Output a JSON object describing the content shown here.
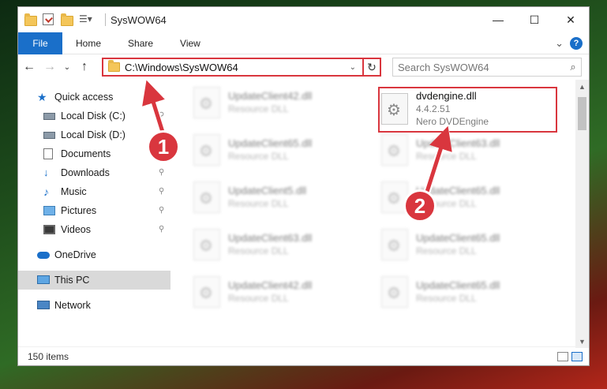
{
  "window": {
    "title": "SysWOW64",
    "minimize": "—",
    "maximize": "☐",
    "close": "✕"
  },
  "ribbon": {
    "file_tab": "File",
    "tabs": [
      "Home",
      "Share",
      "View"
    ],
    "expand": "⌄",
    "help": "?"
  },
  "nav": {
    "back": "←",
    "forward": "→",
    "recent": "⌄",
    "up": "↑",
    "address_path": "C:\\Windows\\SysWOW64",
    "address_dropdown": "⌄",
    "refresh": "↻",
    "search_placeholder": "Search SysWOW64",
    "search_icon": "⌕"
  },
  "sidebar": {
    "items": [
      {
        "label": "Quick access",
        "icon": "star-icon"
      },
      {
        "label": "Local Disk (C:)",
        "icon": "disk-icon",
        "pinned": true
      },
      {
        "label": "Local Disk (D:)",
        "icon": "disk-icon"
      },
      {
        "label": "Documents",
        "icon": "documents-icon",
        "pinned": true
      },
      {
        "label": "Downloads",
        "icon": "downloads-icon",
        "pinned": true
      },
      {
        "label": "Music",
        "icon": "music-icon",
        "pinned": true
      },
      {
        "label": "Pictures",
        "icon": "pictures-icon",
        "pinned": true
      },
      {
        "label": "Videos",
        "icon": "videos-icon",
        "pinned": true
      },
      {
        "label": "OneDrive",
        "icon": "onedrive-icon"
      },
      {
        "label": "This PC",
        "icon": "this-pc-icon",
        "selected": true
      },
      {
        "label": "Network",
        "icon": "network-icon"
      }
    ],
    "pin_glyph": "⚲"
  },
  "files": {
    "highlighted": {
      "name": "dvdengine.dll",
      "version": "4.4.2.51",
      "description": "Nero DVDEngine"
    },
    "left_column": [
      {
        "name": "UpdateClient42.dll",
        "type": "Resource DLL"
      },
      {
        "name": "UpdateClient65.dll",
        "type": "Resource DLL"
      },
      {
        "name": "UpdateClient5.dll",
        "type": "Resource DLL"
      },
      {
        "name": "UpdateClient63.dll",
        "type": "Resource DLL"
      },
      {
        "name": "UpdateClient42.dll",
        "type": "Resource DLL"
      }
    ],
    "right_column": [
      {
        "name": "UpdateClient63.dll",
        "type": "Resource DLL"
      },
      {
        "name": "UpdateClient65.dll",
        "type": "Resource DLL"
      },
      {
        "name": "UpdateClient65.dll",
        "type": "Resource DLL"
      },
      {
        "name": "UpdateClient65.dll",
        "type": "Resource DLL"
      }
    ]
  },
  "status": {
    "item_count": "150 items"
  },
  "scrollbar": {
    "up": "▲",
    "down": "▼"
  },
  "annotations": {
    "badge_1": "1",
    "badge_2": "2",
    "accent_color": "#d9363e"
  }
}
